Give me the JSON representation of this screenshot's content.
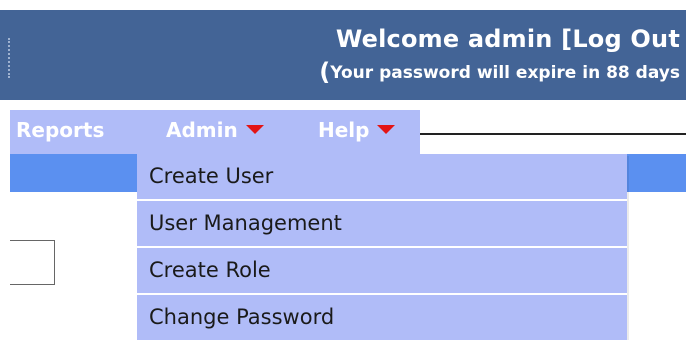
{
  "header": {
    "welcome_prefix": "Welcome admin [",
    "logout_label": "Log Out",
    "expiry_notice": "Your password will expire in 88 days",
    "background_color": "#436496"
  },
  "menubar": {
    "items": [
      {
        "label": "Reports",
        "has_dropdown": false
      },
      {
        "label": "Admin",
        "has_dropdown": true
      },
      {
        "label": "Help",
        "has_dropdown": true
      }
    ],
    "background_color": "#b0bcf8",
    "caret_color": "#e31414"
  },
  "admin_dropdown": {
    "items": [
      {
        "label": "Create User"
      },
      {
        "label": "User Management"
      },
      {
        "label": "Create Role"
      },
      {
        "label": "Change Password"
      }
    ]
  },
  "subbar": {
    "background_color": "#5b90f0"
  }
}
